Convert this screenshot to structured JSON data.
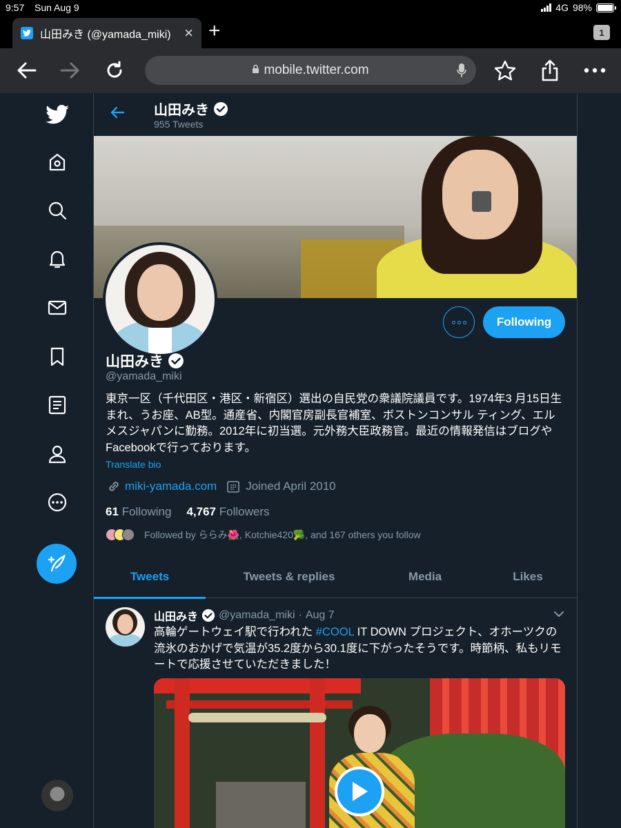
{
  "status_bar": {
    "time": "9:57",
    "date": "Sun Aug 9",
    "network": "4G",
    "battery": "98%",
    "battery_level": 0.98
  },
  "browser": {
    "tab_title": "山田みき (@yamada_miki)",
    "tab_count": "1",
    "url": "mobile.twitter.com"
  },
  "sidenav": {
    "items": [
      "twitter-logo",
      "home-icon",
      "search-icon",
      "bell-icon",
      "mail-icon",
      "bookmark-icon",
      "lists-icon",
      "profile-icon",
      "more-icon"
    ],
    "compose_icon": "compose-icon"
  },
  "header": {
    "name": "山田みき",
    "tweet_count": "955 Tweets"
  },
  "profile": {
    "name": "山田みき",
    "handle": "@yamada_miki",
    "bio": "東京一区（千代田区・港区・新宿区）選出の自民党の衆議院議員です。1974年3 月15日生まれ、うお座、AB型。通産省、内閣官房副長官補室、ボストンコンサル ティング、エルメスジャパンに勤務。2012年に初当選。元外務大臣政務官。最近の情報発信はブログやFacebookで行っております。",
    "translate_label": "Translate bio",
    "website": "miki-yamada.com",
    "joined": "Joined April 2010",
    "following_count": "61",
    "following_label": "Following",
    "followers_count": "4,767",
    "followers_label": "Followers",
    "followed_by": "Followed by ららみ🌺, Kotchie420🥦, and 167 others you follow",
    "follow_button": "Following"
  },
  "profile_tabs": [
    {
      "label": "Tweets",
      "active": true
    },
    {
      "label": "Tweets & replies",
      "active": false
    },
    {
      "label": "Media",
      "active": false
    },
    {
      "label": "Likes",
      "active": false
    }
  ],
  "tweet": {
    "name": "山田みき",
    "handle": "@yamada_miki",
    "separator": "·",
    "date": "Aug 7",
    "text_before": "高輪ゲートウェイ駅で行われた ",
    "hashtag": "#COOL",
    "text_after": " IT DOWN プロジェクト、オホーツクの流氷のおかげで気温が35.2度から30.1度に下がったそうです。時節柄、私もリモートで応援させていただきました！"
  },
  "colors": {
    "accent": "#1da1f2",
    "background": "#15202b",
    "muted": "#8899a6",
    "border": "#38444d"
  }
}
